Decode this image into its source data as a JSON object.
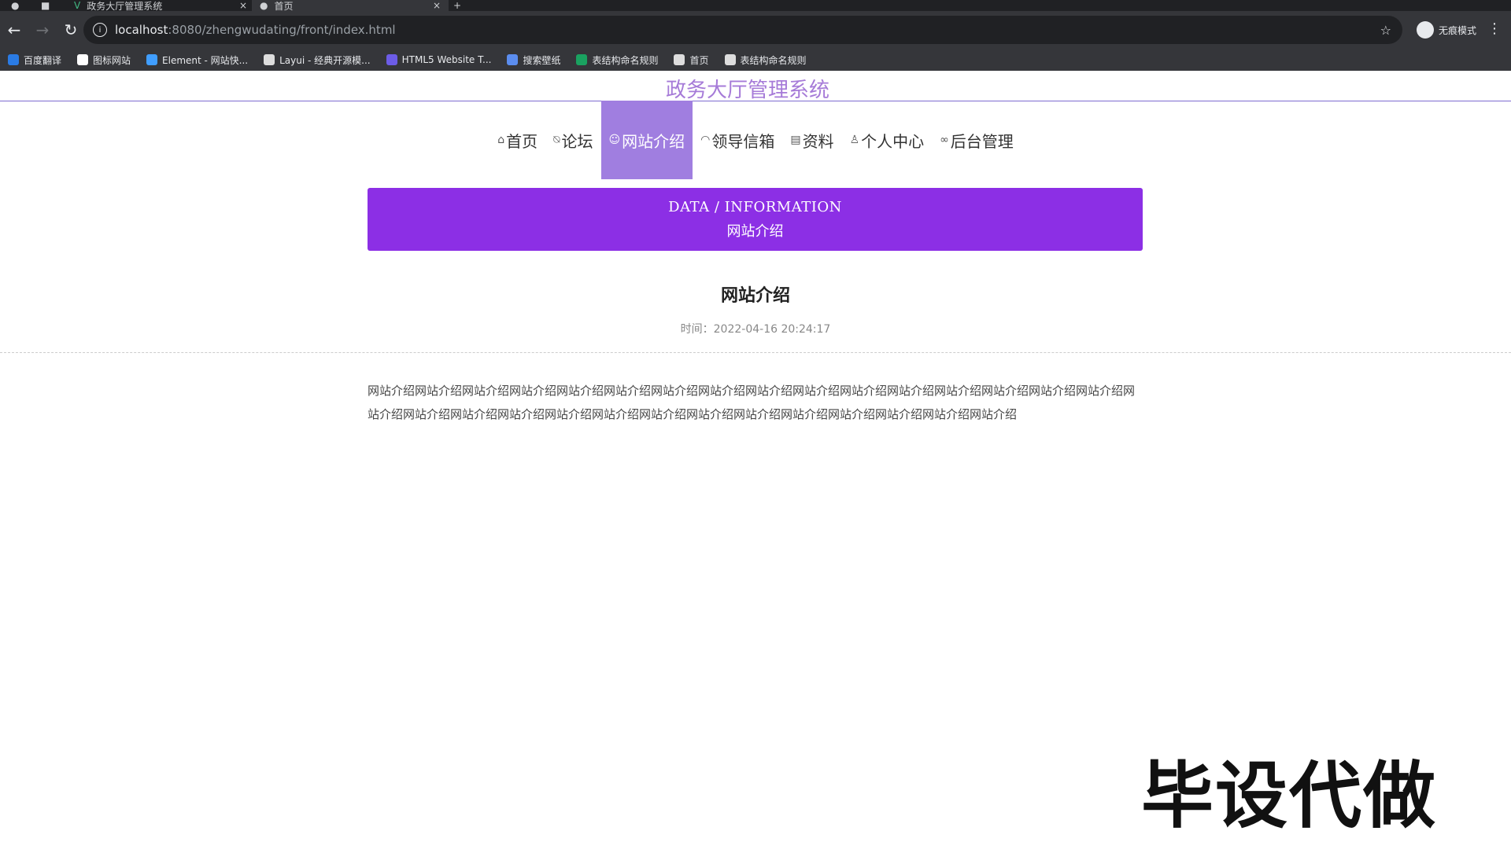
{
  "browser": {
    "tabs": [
      {
        "title": "政务大厅管理系统",
        "active": false
      },
      {
        "title": "首页",
        "active": true
      }
    ],
    "url_host": "localhost",
    "url_path": ":8080/zhengwudating/front/index.html",
    "incognito_label": "无痕模式",
    "bookmarks": [
      {
        "label": "百度翻译",
        "icon": "translate-icon",
        "color": "#2a7be4"
      },
      {
        "label": "图标网站",
        "icon": "flag-icon",
        "color": "#ffffff"
      },
      {
        "label": "Element - 网站快...",
        "icon": "element-icon",
        "color": "#409eff"
      },
      {
        "label": "Layui - 经典开源模...",
        "icon": "layui-icon",
        "color": "#dddddd"
      },
      {
        "label": "HTML5 Website T...",
        "icon": "html5-icon",
        "color": "#6c5ce7"
      },
      {
        "label": "搜索壁纸",
        "icon": "wallpaper-icon",
        "color": "#5b8def"
      },
      {
        "label": "表结构命名规则",
        "icon": "sheet-icon",
        "color": "#1aa260"
      },
      {
        "label": "首页",
        "icon": "globe-icon",
        "color": "#dddddd"
      },
      {
        "label": "表结构命名规则",
        "icon": "globe-icon",
        "color": "#dddddd"
      }
    ]
  },
  "site": {
    "title": "政务大厅管理系统",
    "nav": [
      {
        "label": "首页",
        "icon": "home-icon",
        "glyph": "⌂",
        "active": false
      },
      {
        "label": "论坛",
        "icon": "tag-icon",
        "glyph": "⍉",
        "active": false
      },
      {
        "label": "网站介绍",
        "icon": "smile-icon",
        "glyph": "☺",
        "active": true
      },
      {
        "label": "领导信箱",
        "icon": "dashboard-icon",
        "glyph": "◠",
        "active": false
      },
      {
        "label": "资料",
        "icon": "calendar-icon",
        "glyph": "▤",
        "active": false
      },
      {
        "label": "个人中心",
        "icon": "user-icon",
        "glyph": "♙",
        "active": false
      },
      {
        "label": "后台管理",
        "icon": "link-icon",
        "glyph": "∞",
        "active": false
      }
    ]
  },
  "banner": {
    "en": "DATA / INFORMATION",
    "cn": "网站介绍",
    "color": "#8c2fe5"
  },
  "article": {
    "title": "网站介绍",
    "time_label": "时间：",
    "time": "2022-04-16 20:24:17",
    "body": "网站介绍网站介绍网站介绍网站介绍网站介绍网站介绍网站介绍网站介绍网站介绍网站介绍网站介绍网站介绍网站介绍网站介绍网站介绍网站介绍网站介绍网站介绍网站介绍网站介绍网站介绍网站介绍网站介绍网站介绍网站介绍网站介绍网站介绍网站介绍网站介绍网站介绍"
  },
  "watermark": "毕设代做"
}
